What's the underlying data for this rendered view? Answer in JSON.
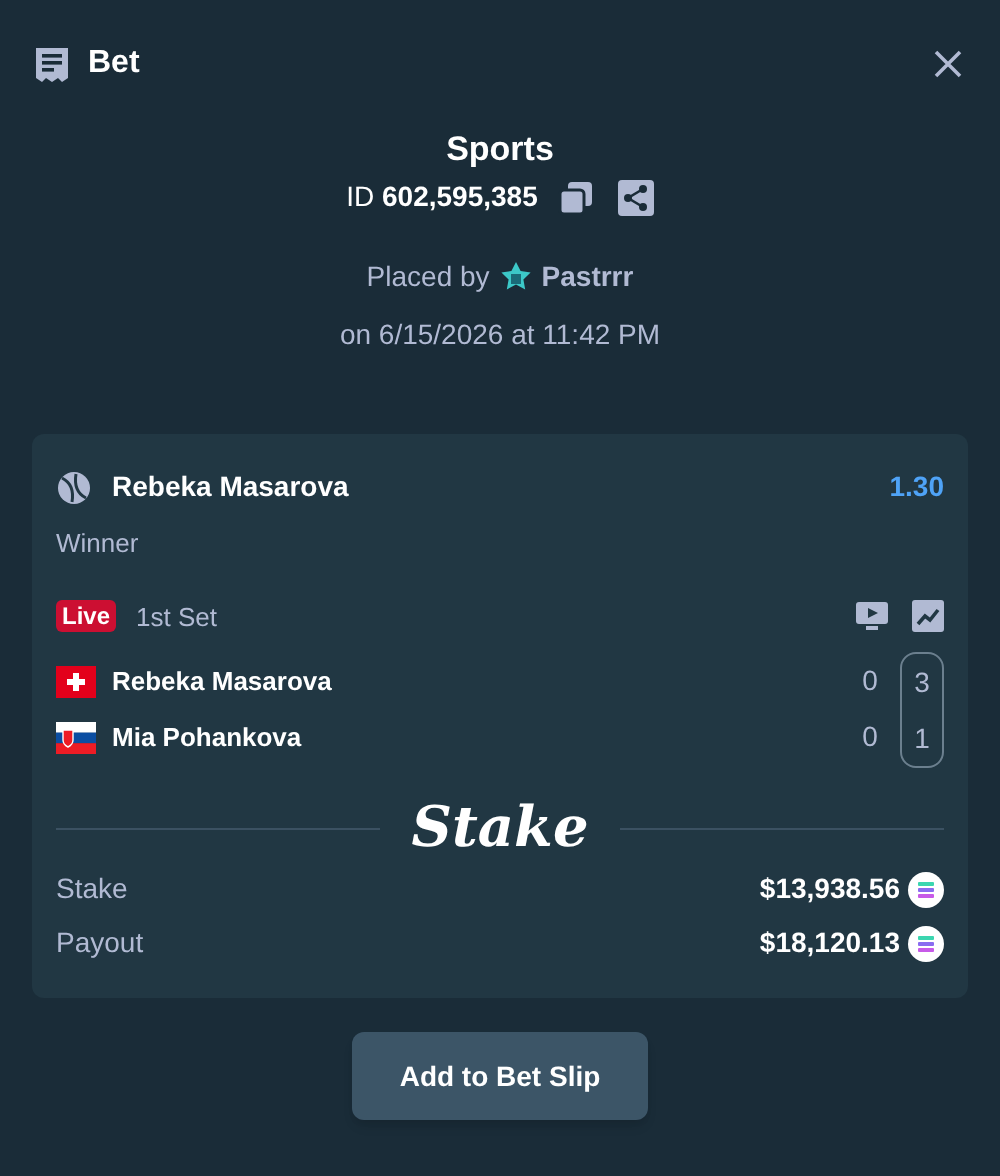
{
  "header": {
    "title": "Bet"
  },
  "summary": {
    "title": "Sports",
    "id_label": "ID",
    "id_value": "602,595,385",
    "placed_by": "Placed by",
    "user": "Pastrrr",
    "date": "on 6/15/2026 at 11:42 PM"
  },
  "bet": {
    "selection": "Rebeka Masarova",
    "odds": "1.30",
    "market": "Winner",
    "live": true,
    "live_label": "Live",
    "period": "1st Set",
    "players": [
      {
        "name": "Rebeka Masarova"
      },
      {
        "name": "Mia Pohankova"
      }
    ],
    "score_columns": [
      {
        "values": [
          "0",
          "0"
        ],
        "boxed": false
      },
      {
        "values": [
          "3",
          "1"
        ],
        "boxed": true
      }
    ],
    "brand": "Stake",
    "amounts": [
      {
        "label": "Stake",
        "value": "$13,938.56"
      },
      {
        "label": "Payout",
        "value": "$18,120.13"
      }
    ]
  },
  "button": "Add to Bet Slip"
}
